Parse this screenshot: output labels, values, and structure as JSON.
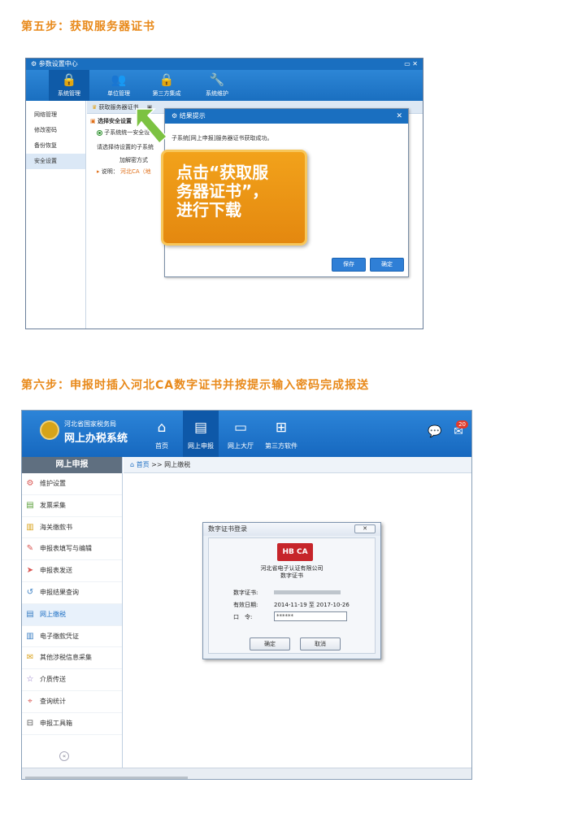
{
  "step5": {
    "title": "第五步：获取服务器证书",
    "window": {
      "title": "参数设置中心",
      "controls": "▭ ✕",
      "nav": [
        {
          "label": "系统管理",
          "icon": "lock-icon"
        },
        {
          "label": "单位管理",
          "icon": "users-icon"
        },
        {
          "label": "第三方集成",
          "icon": "lock-icon"
        },
        {
          "label": "系统维护",
          "icon": "wrench-icon"
        }
      ],
      "sidebar": [
        "网络管理",
        "修改密码",
        "备份恢复",
        "安全设置"
      ],
      "toolbar_button": "获取服务器证书",
      "section_title": "选择安全设置",
      "radio_label": "子系统统一安全设",
      "instruction": "请选择待设置的子系统",
      "decrypt_label": "加解密方式",
      "note_prefix": "说明：",
      "note_text": "河北CA（地"
    },
    "dialog": {
      "title": "结果提示",
      "message": "子系统[网上申报]服务器证书获取成功。",
      "save": "保存",
      "ok": "确定"
    },
    "callout_lines": [
      "点击“获取服",
      "务器证书”，",
      "进行下载"
    ]
  },
  "step6": {
    "title": "第六步：申报时插入河北CA数字证书并按提示输入密码完成报送",
    "app": {
      "org": "河北省国家税务局",
      "name": "网上办税系统",
      "nav": [
        {
          "label": "首页",
          "icon": "home-icon"
        },
        {
          "label": "网上申报",
          "icon": "document-icon"
        },
        {
          "label": "网上大厅",
          "icon": "monitor-icon"
        },
        {
          "label": "第三方软件",
          "icon": "grid-icon"
        }
      ],
      "badge_count": "20",
      "sidebar_head": "网上申报",
      "sidebar": [
        "维护设置",
        "发票采集",
        "海关缴款书",
        "申报表填写与编辑",
        "申报表发送",
        "申报结果查询",
        "网上缴税",
        "电子缴款凭证",
        "其他涉税信息采集",
        "介质传送",
        "查询统计",
        "申报工具箱"
      ],
      "breadcrumb_home": "首页",
      "breadcrumb_sep": ">>",
      "breadcrumb_current": "网上缴税"
    },
    "cert_dialog": {
      "title": "数字证书登录",
      "logo_text": "HB CA",
      "company": "河北省电子认证有限公司",
      "subtitle": "数字证书",
      "cert_label": "数字证书:",
      "valid_label": "有效日期:",
      "valid_from": "2014-11-19",
      "valid_to_word": "至",
      "valid_to": "2017-10-26",
      "pwd_label": "口　令:",
      "pwd_value": "******",
      "ok": "确定",
      "cancel": "取消"
    }
  },
  "colors": {
    "accent": "#e8891a",
    "primary_blue": "#1a6fc0",
    "callout": "#e4880f"
  }
}
